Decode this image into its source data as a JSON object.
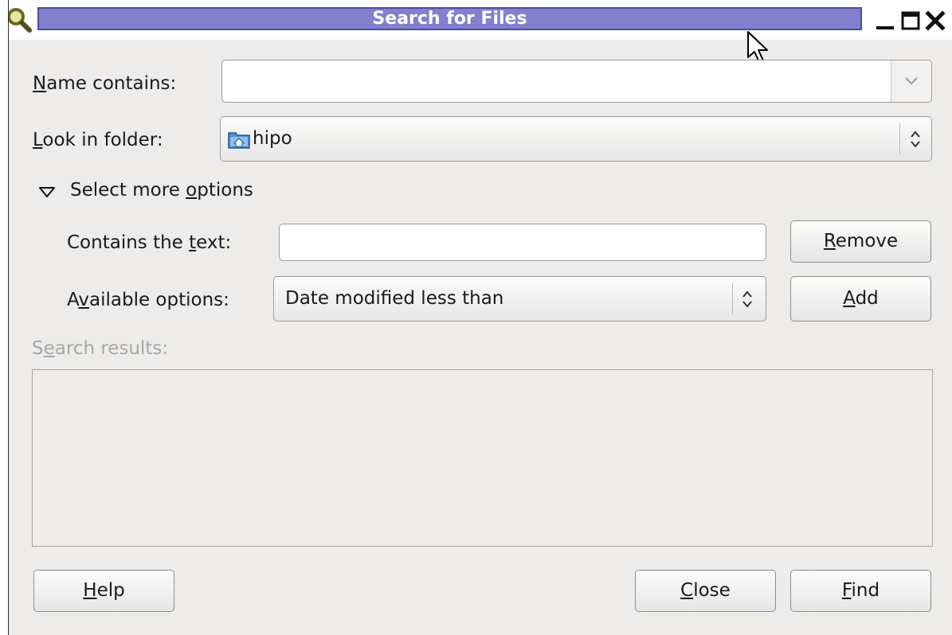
{
  "window": {
    "title": "Search for Files",
    "icons": [
      "search-icon",
      "minimize-icon",
      "maximize-icon",
      "close-icon"
    ]
  },
  "form": {
    "name_contains": {
      "label_pre": "",
      "label_u": "N",
      "label_post": "ame contains:",
      "value": ""
    },
    "look_in_folder": {
      "label_pre": "",
      "label_u": "L",
      "label_post": "ook in folder:",
      "value": "hipo",
      "icon": "home-folder-icon"
    },
    "more_options": {
      "label_pre": "Select more ",
      "label_u": "o",
      "label_post": "ptions",
      "expanded": true
    },
    "contains_text": {
      "label_pre": "Contains the ",
      "label_u": "t",
      "label_post": "ext:",
      "value": ""
    },
    "available_options": {
      "label_pre": "A",
      "label_u": "v",
      "label_post": "ailable options:",
      "selected": "Date modified less than"
    },
    "search_results": {
      "label_pre": "S",
      "label_u": "e",
      "label_post": "arch results:"
    }
  },
  "buttons": {
    "remove": {
      "u": "R",
      "rest": "emove"
    },
    "add": {
      "u": "A",
      "rest": "dd"
    },
    "help": {
      "u": "H",
      "rest": "elp"
    },
    "close": {
      "u": "C",
      "rest": "lose"
    },
    "find": {
      "u": "F",
      "rest": "ind"
    }
  },
  "colors": {
    "title_bar": "#8585d2",
    "window_bg": "#edeceb"
  }
}
